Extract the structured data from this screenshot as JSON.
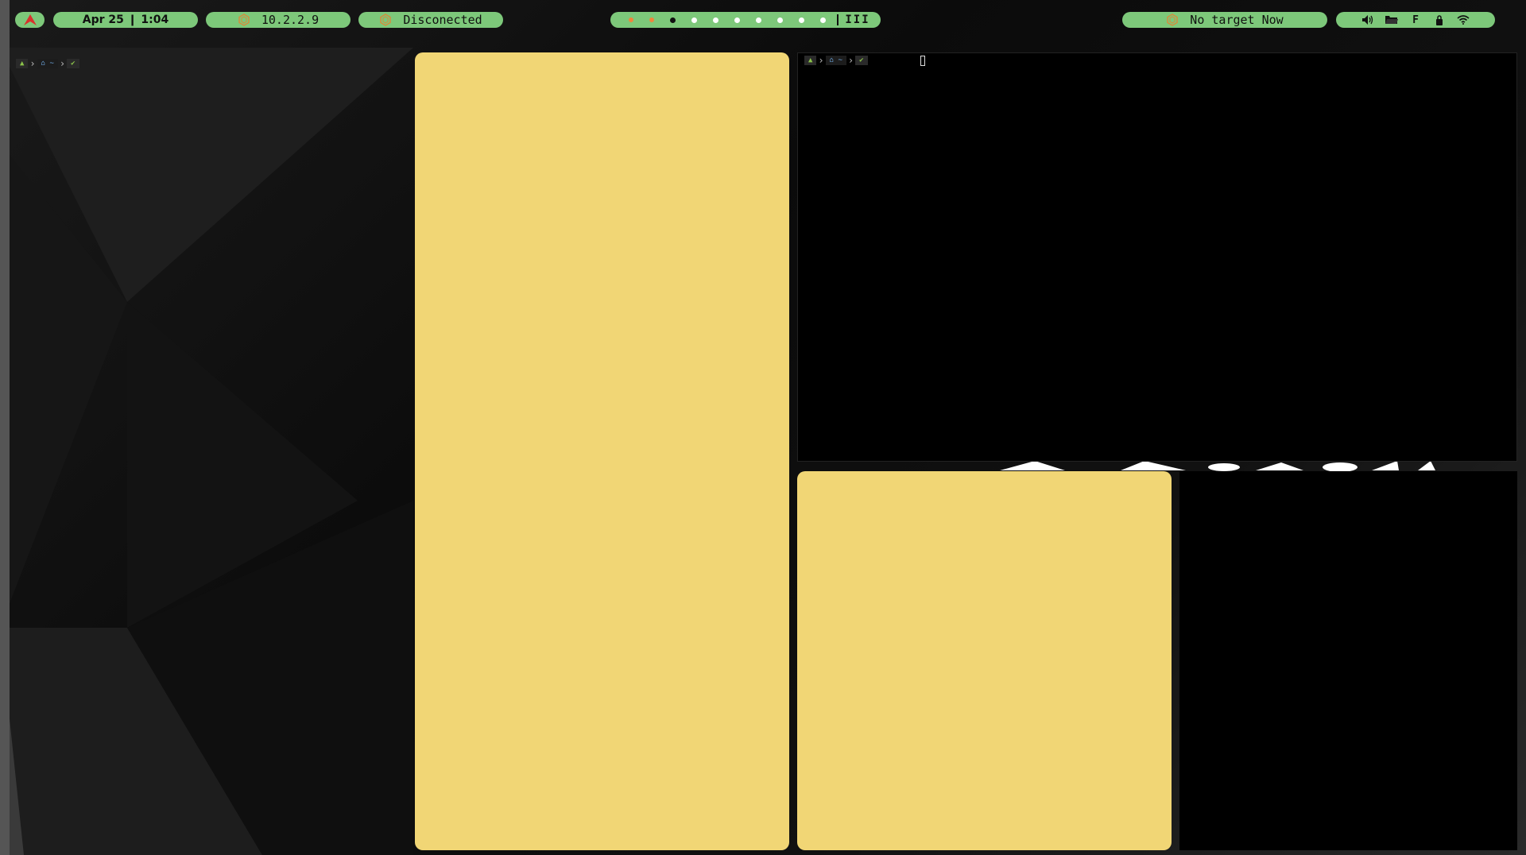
{
  "topbar": {
    "launcher_icon": "arch-logo-icon",
    "datetime": "Apr 25 ❙ 1:04",
    "ip_address": "10.2.2.9",
    "vpn_status": "Disconected",
    "target": "No target Now",
    "layout_label": "III",
    "workspaces": [
      "orange",
      "orange",
      "black",
      "white",
      "white",
      "white",
      "white",
      "white",
      "white",
      "white"
    ],
    "tray": {
      "volume_icon": "volume-icon",
      "folder_icon": "folder-icon",
      "keyboard_label": "F",
      "lock_icon": "lock-icon",
      "wifi_icon": "wifi-icon"
    },
    "accent_color": "#7dc87a",
    "hex_icon_color": "#d98a3b"
  },
  "windows": {
    "left_terminal": {
      "prompt_home": "~",
      "prompt_status_icon": "check-icon"
    },
    "right_terminal": {
      "prompt_home": "~",
      "prompt_status_icon": "check-icon"
    },
    "panel_color": "#f1d675"
  }
}
